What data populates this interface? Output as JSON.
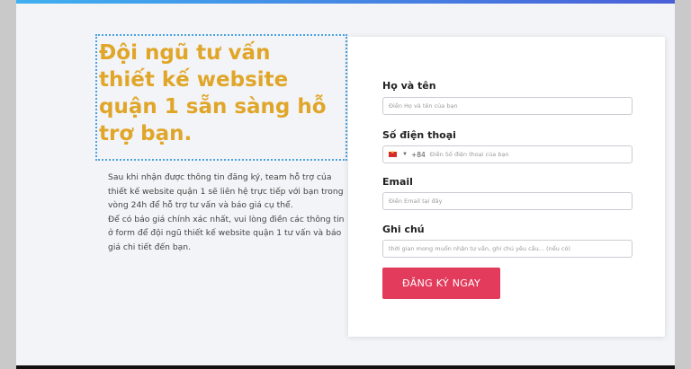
{
  "heading": {
    "lines": [
      "Đội ngũ tư vấn",
      "thiết kế website",
      "quận 1 sẵn sàng hỗ",
      "trợ bạn."
    ]
  },
  "description": {
    "paragraph1": "Sau khi nhận được thông tin đăng ký, team hỗ trợ của thiết kế website quận 1 sẽ liên hệ trực tiếp với bạn trong vòng 24h để hỗ trợ tư vấn và báo giá cụ thể.",
    "paragraph2": "Để có báo giá chính xác nhất, vui lòng điền các thông tin ở form để đội ngũ thiết kế website quận 1 tư vấn và báo giá chi tiết đến bạn."
  },
  "form": {
    "name_label": "Họ và tên",
    "name_placeholder": "Điền Họ và tên của bạn",
    "phone_label": "Số điện thoại",
    "phone_dial_code": "+84",
    "phone_placeholder": "Điền Số điện thoại của bạn",
    "email_label": "Email",
    "email_placeholder": "Điền Email tại đây",
    "note_label": "Ghi chú",
    "note_placeholder": "thời gian mong muốn nhận tư vấn, ghi chú yêu cầu... (nếu có)",
    "submit_label": "ĐĂNG KÝ NGAY"
  },
  "colors": {
    "heading": "#e0a62a",
    "submit": "#e23b5c",
    "top_bar_start": "#3fb0f0",
    "top_bar_end": "#4a5fd8"
  },
  "icons": {
    "flag": "vietnam-flag-icon",
    "dropdown": "caret-down-icon"
  }
}
